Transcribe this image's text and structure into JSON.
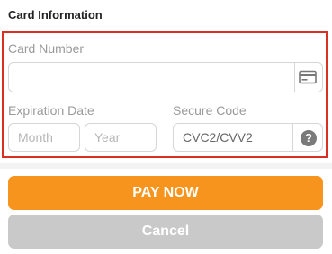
{
  "section": {
    "title": "Card Information"
  },
  "card_number": {
    "label": "Card Number",
    "value": "",
    "icon": "credit-card-icon"
  },
  "expiration": {
    "label": "Expiration Date",
    "month_placeholder": "Month",
    "year_placeholder": "Year"
  },
  "security_code": {
    "label": "Secure Code",
    "placeholder": "CVC2/CVV2",
    "help_icon": "question-circle-icon",
    "help_glyph": "?"
  },
  "actions": {
    "pay_label": "PAY NOW",
    "cancel_label": "Cancel"
  },
  "colors": {
    "highlight_border": "#d93025",
    "pay_button": "#f7941d",
    "cancel_button": "#c9c9c9"
  }
}
